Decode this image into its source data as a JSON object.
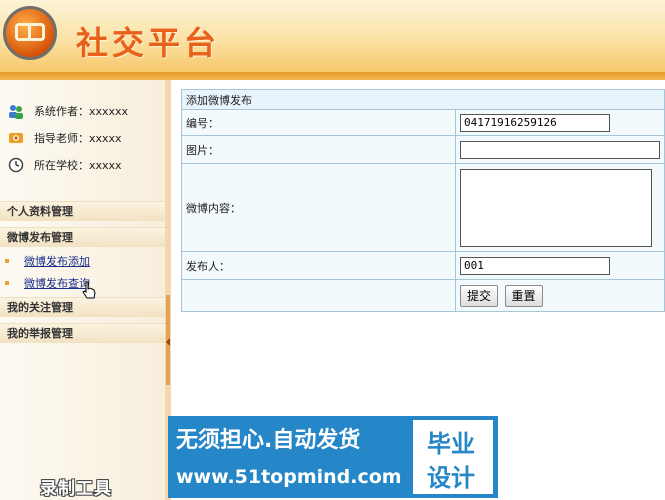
{
  "header": {
    "site_title": "社交平台",
    "logo_icon": "logo-emblem"
  },
  "sidebar": {
    "info": [
      {
        "icon": "users-icon",
        "label": "系统作者：xxxxxx"
      },
      {
        "icon": "teacher-icon",
        "label": "指导老师：xxxxx"
      },
      {
        "icon": "clock-icon",
        "label": "所在学校：xxxxx"
      }
    ],
    "menu": {
      "profile": "个人资料管理",
      "weibo": "微博发布管理",
      "weibo_add": "微博发布添加",
      "weibo_query": "微博发布查询",
      "follow": "我的关注管理",
      "report": "我的举报管理"
    }
  },
  "form": {
    "caption": "添加微博发布",
    "number_label": "编号：",
    "number_value": "04171916259126",
    "image_label": "图片：",
    "image_value": "",
    "content_label": "微博内容：",
    "content_value": "",
    "publisher_label": "发布人：",
    "publisher_value": "001",
    "submit_label": "提交",
    "reset_label": "重置"
  },
  "ad": {
    "slogan": "无须担心.自动发货",
    "url": "www.51topmind.com",
    "box_line1": "毕业",
    "box_line2": "设计"
  },
  "watermark": "录制工具",
  "colors": {
    "accent": "#e8601a",
    "header_bar": "#e79a25",
    "ad_blue": "#2586c8",
    "link": "#1a2d8a"
  }
}
